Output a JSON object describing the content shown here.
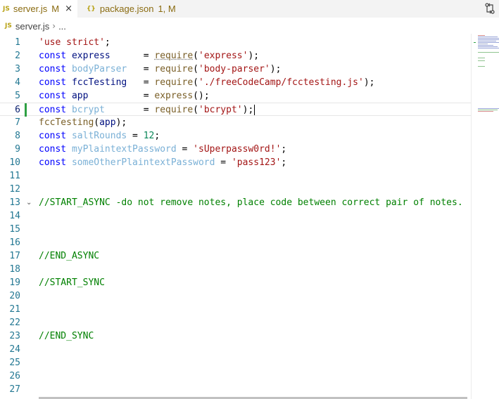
{
  "tabs": [
    {
      "icon": "JS",
      "name": "server.js",
      "status": "M",
      "close": "×",
      "active": true
    },
    {
      "icon": "{}",
      "name": "package.json",
      "status": "1, M",
      "active": false
    }
  ],
  "toolbar": {
    "split_icon": "⇅"
  },
  "breadcrumb": {
    "icon": "JS",
    "file": "server.js",
    "sep": "›",
    "more": "..."
  },
  "editor": {
    "current_line": 6,
    "lines": [
      {
        "n": "1"
      },
      {
        "n": "2"
      },
      {
        "n": "3"
      },
      {
        "n": "4"
      },
      {
        "n": "5"
      },
      {
        "n": "6"
      },
      {
        "n": "7"
      },
      {
        "n": "8"
      },
      {
        "n": "9"
      },
      {
        "n": "10"
      },
      {
        "n": "11"
      },
      {
        "n": "12"
      },
      {
        "n": "13"
      },
      {
        "n": "14"
      },
      {
        "n": "15"
      },
      {
        "n": "16"
      },
      {
        "n": "17"
      },
      {
        "n": "18"
      },
      {
        "n": "19"
      },
      {
        "n": "20"
      },
      {
        "n": "21"
      },
      {
        "n": "22"
      },
      {
        "n": "23"
      },
      {
        "n": "24"
      },
      {
        "n": "25"
      },
      {
        "n": "26"
      },
      {
        "n": "27"
      }
    ],
    "tokens": {
      "l1": [
        "'use strict'",
        ";"
      ],
      "l2": [
        "const",
        " express     ",
        " = ",
        "require",
        "(",
        "'express'",
        ");"
      ],
      "l3": [
        "const",
        " bodyParser  ",
        " = ",
        "require",
        "(",
        "'body-parser'",
        ");"
      ],
      "l4": [
        "const",
        " fccTesting  ",
        " = ",
        "require",
        "(",
        "'./freeCodeCamp/fcctesting.js'",
        ");"
      ],
      "l5": [
        "const",
        " app         ",
        " = ",
        "express",
        "();"
      ],
      "l6": [
        "const",
        " bcrypt      ",
        " = ",
        "require",
        "(",
        "'bcrypt'",
        ");"
      ],
      "l7": [
        "fccTesting",
        "(",
        "app",
        ");"
      ],
      "l8": [
        "const",
        " saltRounds",
        " = ",
        "12",
        ";"
      ],
      "l9": [
        "const",
        " myPlaintextPassword",
        " = ",
        "'sUperpassw0rd!'",
        ";"
      ],
      "l10": [
        "const",
        " someOtherPlaintextPassword",
        " = ",
        "'pass123'",
        ";"
      ],
      "l13": "//START_ASYNC -do not remove notes, place code between correct pair of notes.",
      "l17": "//END_ASYNC",
      "l19": "//START_SYNC",
      "l23": "//END_SYNC"
    },
    "fold_icon": "⌄"
  },
  "colors": {
    "keyword": "#0000ff",
    "string": "#a31515",
    "comment": "#008000",
    "number": "#098658",
    "function": "#795e26",
    "line_number": "#237893",
    "modified_bar": "#2ea043"
  }
}
